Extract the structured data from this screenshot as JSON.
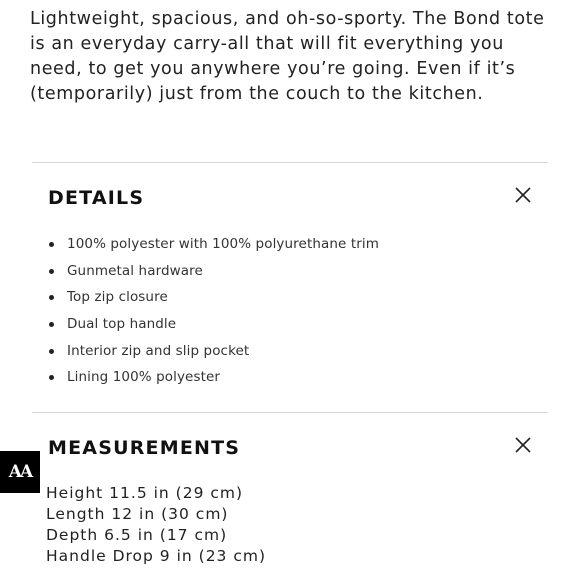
{
  "description": "Lightweight, spacious, and oh-so-sporty. The Bond tote is an everyday carry-all that will fit everything you need, to get you anywhere you’re going. Even if it’s (temporarily) just from the couch to the kitchen.",
  "details": {
    "title": "DETAILS",
    "close_icon": "close-x-icon",
    "items": [
      "100% polyester with 100% polyurethane trim",
      "Gunmetal hardware",
      "Top zip closure",
      "Dual top handle",
      "Interior zip and slip pocket",
      "Lining 100% polyester"
    ]
  },
  "measurements": {
    "title": "MEASUREMENTS",
    "close_icon": "close-x-icon",
    "items": [
      "Height 11.5 in (29 cm)",
      "Length 12 in (30 cm)",
      "Depth 6.5 in (17 cm)",
      "Handle Drop 9 in (23 cm)"
    ]
  },
  "badge": {
    "text": "AA"
  }
}
